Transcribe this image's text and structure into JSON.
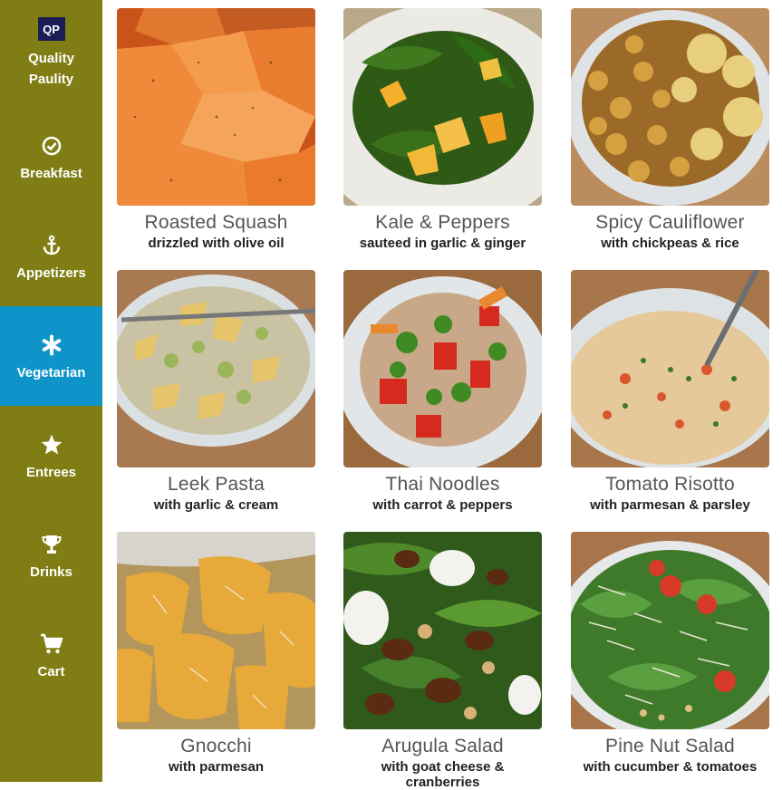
{
  "brand": {
    "logo_abbr": "QP",
    "name_line1": "Quality",
    "name_line2": "Paulity"
  },
  "sidebar": {
    "items": [
      {
        "label": "Breakfast",
        "icon": "clock-icon",
        "active": false
      },
      {
        "label": "Appetizers",
        "icon": "anchor-icon",
        "active": false
      },
      {
        "label": "Vegetarian",
        "icon": "asterisk-icon",
        "active": true
      },
      {
        "label": "Entrees",
        "icon": "star-icon",
        "active": false
      },
      {
        "label": "Drinks",
        "icon": "trophy-icon",
        "active": false
      },
      {
        "label": "Cart",
        "icon": "cart-icon",
        "active": false
      }
    ]
  },
  "colors": {
    "sidebar_bg": "#7f7d14",
    "active_bg": "#0f94c9",
    "logo_bg": "#1b1d57"
  },
  "dishes": [
    {
      "title": "Roasted Squash",
      "subtitle": "drizzled with olive oil"
    },
    {
      "title": "Kale & Peppers",
      "subtitle": "sauteed in garlic & ginger"
    },
    {
      "title": "Spicy Cauliflower",
      "subtitle": "with chickpeas & rice"
    },
    {
      "title": "Leek Pasta",
      "subtitle": "with garlic & cream"
    },
    {
      "title": "Thai Noodles",
      "subtitle": "with carrot & peppers"
    },
    {
      "title": "Tomato Risotto",
      "subtitle": "with parmesan & parsley"
    },
    {
      "title": "Gnocchi",
      "subtitle": "with parmesan"
    },
    {
      "title": "Arugula Salad",
      "subtitle": "with goat cheese & cranberries"
    },
    {
      "title": "Pine Nut Salad",
      "subtitle": "with cucumber & tomatoes"
    }
  ]
}
